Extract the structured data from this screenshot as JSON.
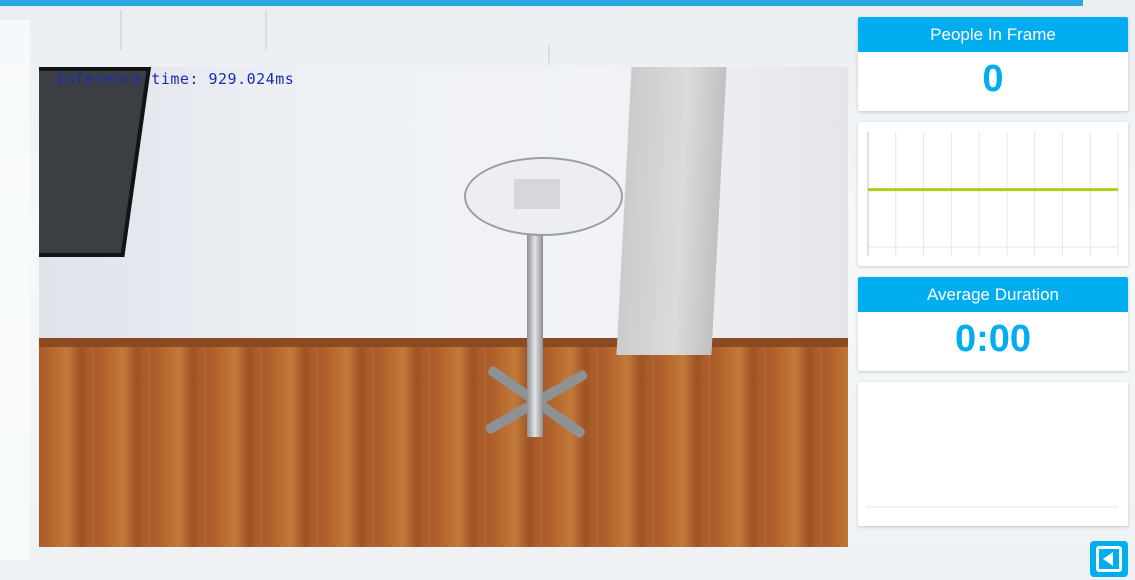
{
  "video": {
    "overlay_text": "Inference time: 929.024ms"
  },
  "people_panel": {
    "title": "People In Frame",
    "value": "0"
  },
  "duration_panel": {
    "title": "Average Duration",
    "value": "0:00"
  },
  "chart_data": [
    {
      "type": "line",
      "title": "",
      "series": [
        {
          "values": [
            0.5,
            0.5,
            0.5,
            0.5,
            0.5,
            0.5,
            0.5,
            0.5,
            0.5,
            0.5
          ]
        }
      ],
      "grid": true,
      "color": "#b5cc18"
    }
  ],
  "colors": {
    "accent": "#00aef0",
    "progress": "#29a9e1",
    "line": "#b5cc18"
  },
  "icons": {
    "collapse": "collapse-left-icon"
  }
}
